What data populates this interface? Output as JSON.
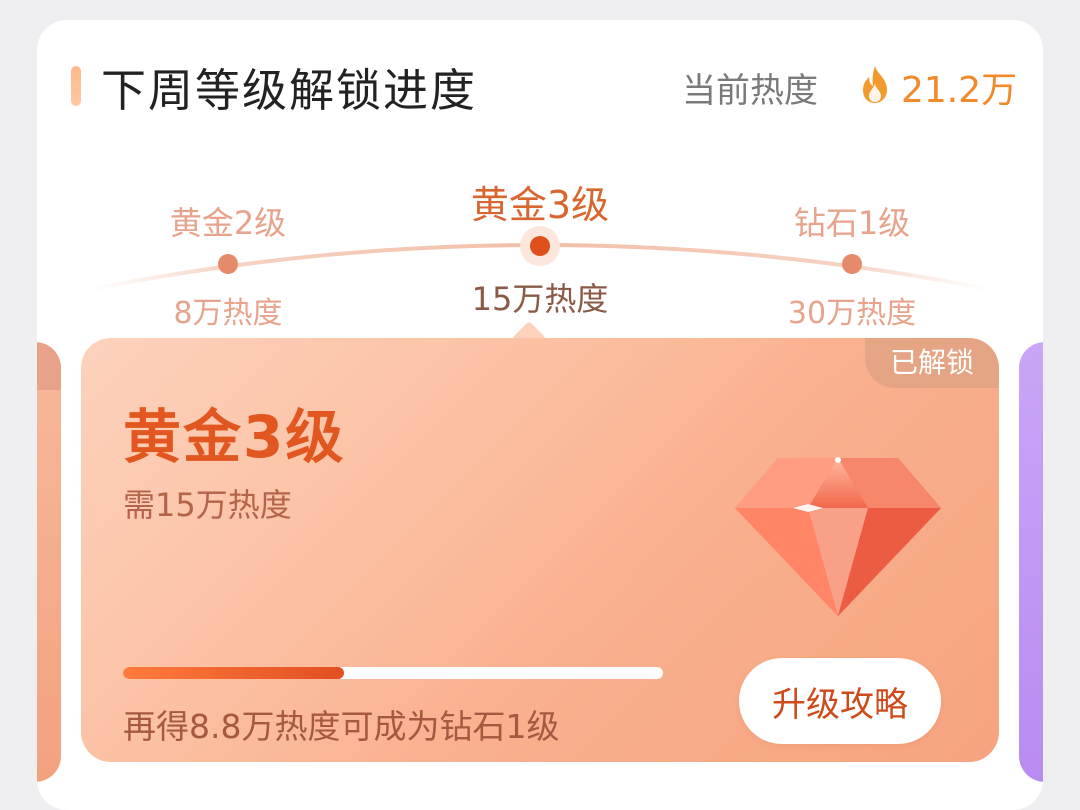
{
  "header": {
    "title": "下周等级解锁进度",
    "current_heat_label": "当前热度",
    "current_heat_value": "21.2万",
    "flame_icon": "flame-icon"
  },
  "levels": [
    {
      "name": "黄金2级",
      "requirement": "8万热度"
    },
    {
      "name": "黄金3级",
      "requirement": "15万热度"
    },
    {
      "name": "钻石1级",
      "requirement": "30万热度"
    }
  ],
  "card": {
    "badge": "已解锁",
    "title": "黄金3级",
    "subtitle": "需15万热度",
    "progress_fraction": 0.41,
    "hint": "再得8.8万热度可成为钻石1级",
    "button_label": "升级攻略",
    "gem_icon": "gem-icon"
  },
  "colors": {
    "accent": "#e0501c",
    "heat": "#f08a2a",
    "card_title": "#e2561f"
  }
}
